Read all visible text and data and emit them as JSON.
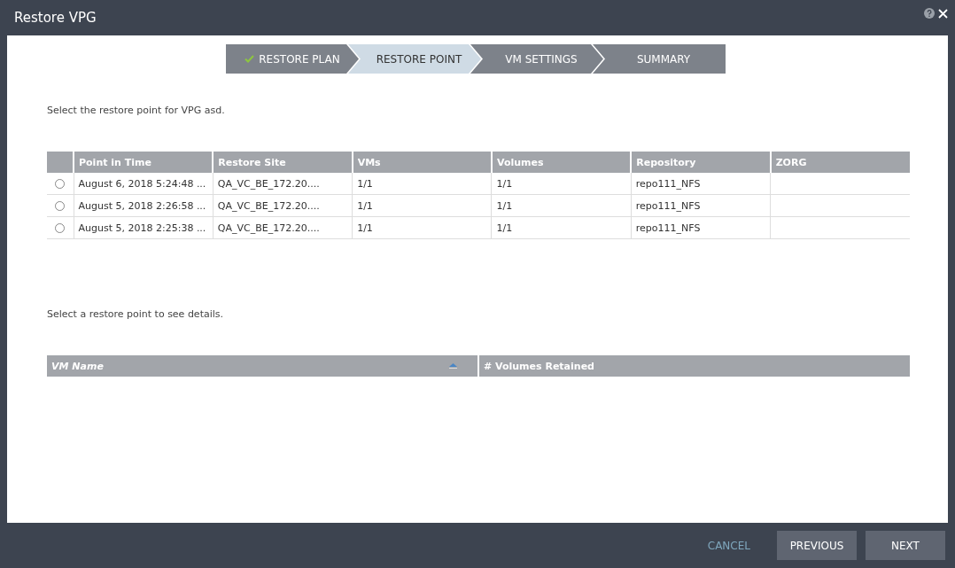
{
  "window": {
    "title": "Restore VPG"
  },
  "steps": [
    {
      "label": "RESTORE PLAN",
      "done": true,
      "selected": false
    },
    {
      "label": "RESTORE POINT",
      "done": false,
      "selected": true
    },
    {
      "label": "VM SETTINGS",
      "done": false,
      "selected": false
    },
    {
      "label": "SUMMARY",
      "done": false,
      "selected": false
    }
  ],
  "instruction": "Select the restore point for VPG asd.",
  "restore_points": {
    "columns": [
      "Point in Time",
      "Restore Site",
      "VMs",
      "Volumes",
      "Repository",
      "ZORG"
    ],
    "rows": [
      {
        "selected": false,
        "cells": [
          "August 6, 2018 5:24:48 ...",
          "QA_VC_BE_172.20....",
          "1/1",
          "1/1",
          "repo111_NFS",
          null
        ]
      },
      {
        "selected": false,
        "cells": [
          "August 5, 2018 2:26:58 ...",
          "QA_VC_BE_172.20....",
          "1/1",
          "1/1",
          "repo111_NFS",
          null
        ]
      },
      {
        "selected": false,
        "cells": [
          "August 5, 2018 2:25:38 ...",
          "QA_VC_BE_172.20....",
          "1/1",
          "1/1",
          "repo111_NFS",
          null
        ]
      }
    ]
  },
  "details_hint": "Select a restore point to see details.",
  "details": {
    "columns": [
      "VM Name",
      "# Volumes Retained"
    ]
  },
  "buttons": {
    "cancel": "CANCEL",
    "previous": "PREVIOUS",
    "next": "NEXT"
  }
}
